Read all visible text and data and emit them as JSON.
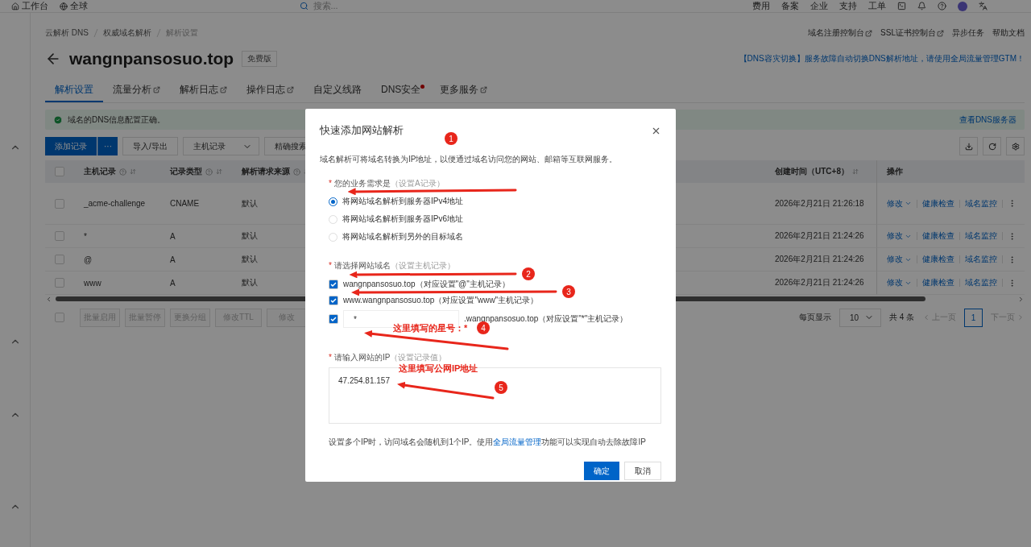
{
  "top_bar": {
    "home": "工作台",
    "region": "全球",
    "search": {
      "placeholder": "搜索..."
    },
    "links": [
      "费用",
      "备案",
      "企业",
      "支持",
      "工单"
    ]
  },
  "breadcrumb": [
    "云解析 DNS",
    "权威域名解析",
    "解析设置"
  ],
  "header_links": [
    {
      "label": "域名注册控制台",
      "external": true
    },
    {
      "label": "SSL证书控制台",
      "external": true
    },
    {
      "label": "异步任务",
      "external": false
    },
    {
      "label": "帮助文档",
      "external": false
    }
  ],
  "title": "wangnpansosuo.top",
  "badge": "免费版",
  "promo": "【DNS容灾切换】服务故障自动切换DNS解析地址，请使用全局流量管理GTM！",
  "tabs": [
    {
      "label": "解析设置",
      "selected": true,
      "external": false,
      "dot": false
    },
    {
      "label": "流量分析",
      "selected": false,
      "external": true,
      "dot": false
    },
    {
      "label": "解析日志",
      "selected": false,
      "external": true,
      "dot": false
    },
    {
      "label": "操作日志",
      "selected": false,
      "external": true,
      "dot": false
    },
    {
      "label": "自定义线路",
      "selected": false,
      "external": false,
      "dot": false
    },
    {
      "label": "DNS安全",
      "selected": false,
      "external": false,
      "dot": true
    },
    {
      "label": "更多服务",
      "selected": false,
      "external": true,
      "dot": false
    }
  ],
  "alert": {
    "message": "域名的DNS信息配置正确。",
    "link": "查看DNS服务器"
  },
  "toolbar": {
    "add": "添加记录",
    "more": "···",
    "import": "导入/导出",
    "field_select": "主机记录",
    "mode_select": "精确搜索"
  },
  "table": {
    "all_checked": false,
    "columns": [
      "主机记录",
      "记录类型",
      "解析请求来源",
      "创建时间（UTC+8）",
      "操作"
    ],
    "rows": [
      {
        "checked": false,
        "host": "_acme-challenge",
        "type": "CNAME",
        "source": "默认",
        "created": "2026年2月21日 21:26:18",
        "actions": [
          "修改",
          "健康检查",
          "域名监控"
        ]
      },
      {
        "checked": false,
        "host": "*",
        "type": "A",
        "source": "默认",
        "created": "2026年2月21日 21:24:26",
        "actions": [
          "修改",
          "健康检查",
          "域名监控"
        ]
      },
      {
        "checked": false,
        "host": "@",
        "type": "A",
        "source": "默认",
        "created": "2026年2月21日 21:24:26",
        "actions": [
          "修改",
          "健康检查",
          "域名监控"
        ]
      },
      {
        "checked": false,
        "host": "www",
        "type": "A",
        "source": "默认",
        "created": "2026年2月21日 21:24:26",
        "actions": [
          "修改",
          "健康检查",
          "域名监控"
        ]
      }
    ]
  },
  "batch": {
    "checked": false,
    "buttons": [
      "批量启用",
      "批量暂停",
      "更换分组",
      "修改TTL",
      "修改"
    ]
  },
  "pagination": {
    "per_page_label": "每页显示",
    "per_page": "10",
    "total": "共 4 条",
    "prev": "上一页",
    "pages": [
      {
        "label": "1",
        "selected": true
      }
    ],
    "next": "下一页"
  },
  "dialog": {
    "title": "快速添加网站解析",
    "description": "域名解析可将域名转换为IP地址，以便通过域名访问您的网站、邮箱等互联网服务。",
    "need": {
      "mark": "*",
      "label": "您的业务需求是",
      "hint": "（设置A记录）",
      "options": [
        {
          "label": "将网站域名解析到服务器IPv4地址",
          "selected": true
        },
        {
          "label": "将网站域名解析到服务器IPv6地址",
          "selected": false
        },
        {
          "label": "将网站域名解析到另外的目标域名",
          "selected": false
        }
      ]
    },
    "domains": {
      "mark": "*",
      "label": "请选择网站域名",
      "hint": "（设置主机记录）",
      "options": [
        {
          "kind": "plain",
          "checked": true,
          "label": "wangnpansosuo.top（对应设置\"@\"主机记录）"
        },
        {
          "kind": "plain",
          "checked": true,
          "label": "www.wangnpansosuo.top（对应设置\"www\"主机记录）"
        },
        {
          "kind": "input",
          "checked": true,
          "value": "*",
          "suffix": ".wangnpansosuo.top（对应设置\"*\"主机记录）"
        }
      ]
    },
    "ip": {
      "mark": "*",
      "label": "请输入网站的IP",
      "hint": "（设置记录值）",
      "value": "47.254.81.157"
    },
    "note": {
      "before": "设置多个IP时，访问域名会随机到1个IP。使用",
      "link": "全局流量管理",
      "after": "功能可以实现自动去除故障IP"
    },
    "ok": "确定",
    "cancel": "取消"
  },
  "annotations": {
    "steps": [
      "1",
      "2",
      "3",
      "4",
      "5"
    ],
    "notes": [
      "这里填写的星号：*",
      "这里填写公网IP地址"
    ]
  }
}
